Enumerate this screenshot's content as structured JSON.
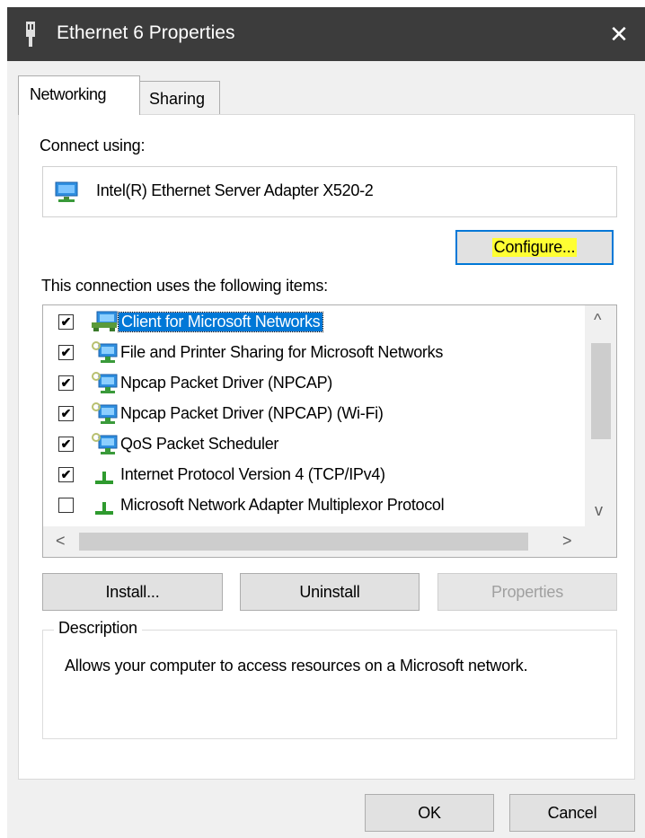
{
  "window": {
    "title": "Ethernet 6 Properties",
    "close_glyph": "✕",
    "accent": "#0078d7",
    "highlight": "#ffff33"
  },
  "tabs": [
    {
      "label": "Networking"
    },
    {
      "label": "Sharing"
    }
  ],
  "connect": {
    "label": "Connect using:",
    "adapter": "Intel(R) Ethernet Server Adapter X520-2"
  },
  "configure_label": "Configure...",
  "items_label": "This connection uses the following items:",
  "items": [
    {
      "label": "Client for Microsoft Networks",
      "checked": true,
      "icon": "network-client-icon",
      "selected": true
    },
    {
      "label": "File and Printer Sharing for Microsoft Networks",
      "checked": true,
      "icon": "network-service-icon"
    },
    {
      "label": "Npcap Packet Driver (NPCAP)",
      "checked": true,
      "icon": "network-service-icon"
    },
    {
      "label": "Npcap Packet Driver (NPCAP) (Wi-Fi)",
      "checked": true,
      "icon": "network-service-icon"
    },
    {
      "label": "QoS Packet Scheduler",
      "checked": true,
      "icon": "network-service-icon"
    },
    {
      "label": "Internet Protocol Version 4 (TCP/IPv4)",
      "checked": true,
      "icon": "protocol-icon"
    },
    {
      "label": "Microsoft Network Adapter Multiplexor Protocol",
      "checked": false,
      "icon": "protocol-icon"
    }
  ],
  "scroll": {
    "up": "^",
    "down": "v",
    "left": "<",
    "right": ">"
  },
  "buttons": {
    "install": "Install...",
    "uninstall": "Uninstall",
    "properties": "Properties",
    "ok": "OK",
    "cancel": "Cancel"
  },
  "description": {
    "legend": "Description",
    "text": "Allows your computer to access resources on a Microsoft network."
  }
}
